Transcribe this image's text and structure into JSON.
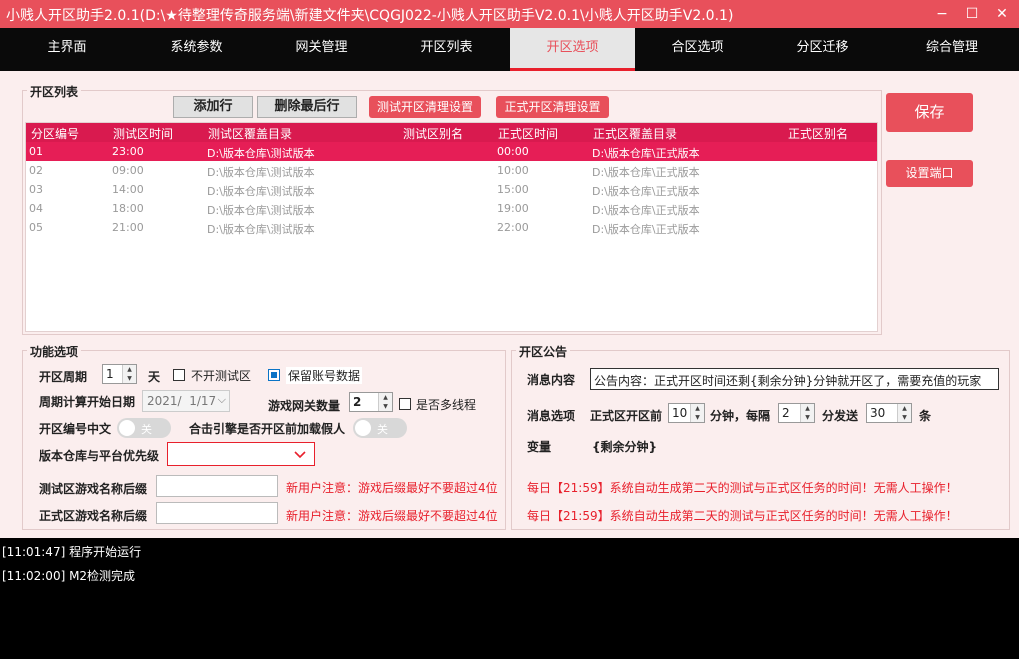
{
  "window": {
    "title": "小贱人开区助手2.0.1(D:\\★待整理传奇服务端\\新建文件夹\\CQGJ022-小贱人开区助手V2.0.1\\小贱人开区助手V2.0.1)",
    "minimize": "−",
    "maximize": "☐",
    "close": "✕"
  },
  "nav": {
    "tabs": [
      "主界面",
      "系统参数",
      "网关管理",
      "开区列表",
      "开区选项",
      "合区选项",
      "分区迁移",
      "综合管理"
    ],
    "active_index": 4
  },
  "list_group": {
    "title": "开区列表",
    "add_row": "添加行",
    "delete_last_row": "删除最后行",
    "test_clean_settings": "测试开区清理设置",
    "formal_clean_settings": "正式开区清理设置",
    "columns": [
      "分区编号",
      "测试区时间",
      "测试区覆盖目录",
      "测试区别名",
      "正式区时间",
      "正式区覆盖目录",
      "正式区别名"
    ],
    "rows": [
      {
        "id": "01",
        "test_time": "23:00",
        "test_dir": "D:\\版本仓库\\测试版本",
        "test_alias": "",
        "formal_time": "00:00",
        "formal_dir": "D:\\版本仓库\\正式版本",
        "formal_alias": ""
      },
      {
        "id": "02",
        "test_time": "09:00",
        "test_dir": "D:\\版本仓库\\测试版本",
        "test_alias": "",
        "formal_time": "10:00",
        "formal_dir": "D:\\版本仓库\\正式版本",
        "formal_alias": ""
      },
      {
        "id": "03",
        "test_time": "14:00",
        "test_dir": "D:\\版本仓库\\测试版本",
        "test_alias": "",
        "formal_time": "15:00",
        "formal_dir": "D:\\版本仓库\\正式版本",
        "formal_alias": ""
      },
      {
        "id": "04",
        "test_time": "18:00",
        "test_dir": "D:\\版本仓库\\测试版本",
        "test_alias": "",
        "formal_time": "19:00",
        "formal_dir": "D:\\版本仓库\\正式版本",
        "formal_alias": ""
      },
      {
        "id": "05",
        "test_time": "21:00",
        "test_dir": "D:\\版本仓库\\测试版本",
        "test_alias": "",
        "formal_time": "22:00",
        "formal_dir": "D:\\版本仓库\\正式版本",
        "formal_alias": ""
      }
    ],
    "selected_row": 0
  },
  "side": {
    "save": "保存",
    "set_port": "设置端口"
  },
  "func_group": {
    "title": "功能选项",
    "cycle_label": "开区周期",
    "cycle_value": "1",
    "cycle_unit": "天",
    "no_test_label": "不开测试区",
    "keep_account_label": "保留账号数据",
    "no_test_checked": false,
    "keep_account_checked": true,
    "start_date_label": "周期计算开始日期",
    "start_date_value": "2021/  1/17",
    "gateway_count_label": "游戏网关数量",
    "gateway_count_value": "2",
    "multithread_label": "是否多线程",
    "multithread_checked": false,
    "cn_number_label": "开区编号中文",
    "cn_number_toggle": "关",
    "preload_label": "合击引擎是否开区前加载假人",
    "preload_toggle": "关",
    "priority_label": "版本仓库与平台优先级",
    "priority_value": "",
    "test_suffix_label": "测试区游戏名称后缀",
    "test_suffix_value": "",
    "formal_suffix_label": "正式区游戏名称后缀",
    "formal_suffix_value": "",
    "suffix_warning": "新用户注意：游戏后缀最好不要超过4位"
  },
  "notice_group": {
    "title": "开区公告",
    "content_label": "消息内容",
    "content_value": "公告内容：正式开区时间还剩{剩余分钟}分钟就开区了，需要充值的玩家",
    "options_label": "消息选项",
    "before_label": "正式区开区前",
    "before_value": "10",
    "minutes_every": "分钟，每隔",
    "interval_value": "2",
    "minutes_send": "分发送",
    "count_value": "30",
    "count_unit": "条",
    "variable_label": "变量",
    "variable_value": "{剩余分钟}",
    "daily_line_1": "每日【21:59】系统自动生成第二天的测试与正式区任务的时间！无需人工操作！",
    "daily_line_2": "每日【21:59】系统自动生成第二天的测试与正式区任务的时间！无需人工操作！"
  },
  "log": [
    "[11:01:47] 程序开始运行",
    "[11:02:00] M2检测完成"
  ],
  "colors": {
    "accent": "#e8505b",
    "selected_row": "#e61e56",
    "header": "#d91a4f",
    "warning": "#e8202c"
  }
}
